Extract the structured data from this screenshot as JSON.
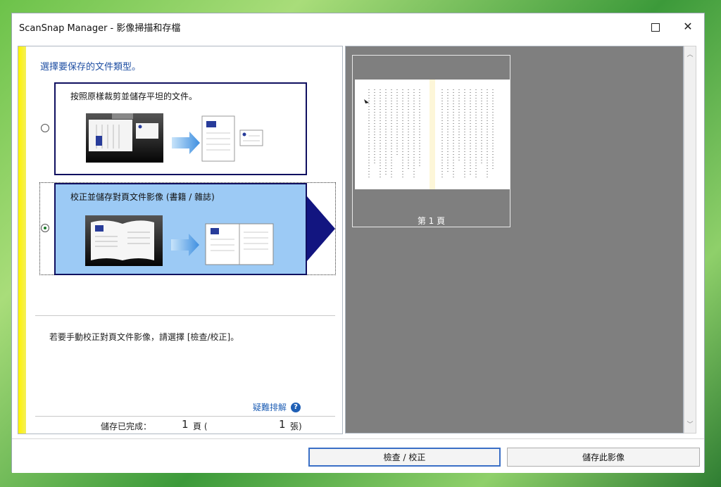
{
  "window": {
    "title": "ScanSnap Manager - 影像掃描和存檔",
    "controls": {
      "minimize": "—",
      "maximize": "",
      "close": "✕"
    }
  },
  "left": {
    "heading": "選擇要保存的文件類型。",
    "option1": {
      "label": "按照原樣裁剪並儲存平坦的文件。",
      "selected": false
    },
    "option2": {
      "label": "校正並儲存對頁文件影像 (書籍 / 雜誌)",
      "selected": true
    },
    "hint": "若要手動校正對頁文件影像，請選擇 [檢查/校正]。",
    "help": {
      "label": "疑難排解",
      "icon": "help-icon"
    },
    "status": {
      "label": "儲存已完成：",
      "pages": "1",
      "pages_unit": "頁 (",
      "sheets": "1",
      "sheets_unit": "張)"
    }
  },
  "preview": {
    "caption": "第 1 頁"
  },
  "buttons": {
    "check": "檢查 / 校正",
    "save": "儲存此影像"
  },
  "colors": {
    "accent": "#121580",
    "selected_bg": "#9ccaf5",
    "bar": "#fff200"
  }
}
